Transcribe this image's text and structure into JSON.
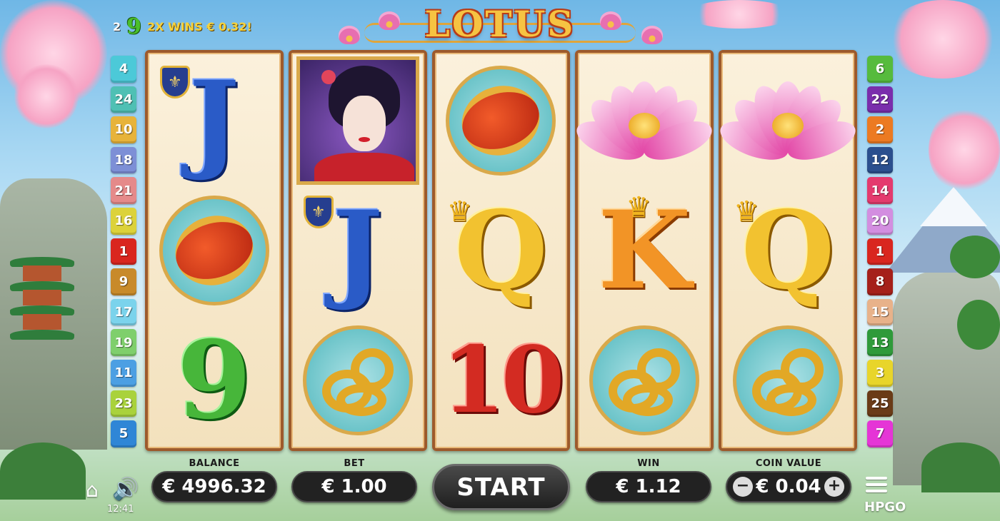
{
  "game": {
    "title": "LOTUS"
  },
  "win_message": {
    "line": "2",
    "symbol": "9",
    "text": "2X WINS € 0.32!"
  },
  "paylines": {
    "left": [
      {
        "number": "4",
        "color": "#4cc9d8"
      },
      {
        "number": "24",
        "color": "#4fc0b4"
      },
      {
        "number": "10",
        "color": "#e7b33a"
      },
      {
        "number": "18",
        "color": "#7d8fd6"
      },
      {
        "number": "21",
        "color": "#e58a8a"
      },
      {
        "number": "16",
        "color": "#dcd23a"
      },
      {
        "number": "1",
        "color": "#d9261f"
      },
      {
        "number": "9",
        "color": "#c88a2a"
      },
      {
        "number": "17",
        "color": "#7bd3ec"
      },
      {
        "number": "19",
        "color": "#7fcf6c"
      },
      {
        "number": "11",
        "color": "#4c9fe3"
      },
      {
        "number": "23",
        "color": "#a9d23c"
      },
      {
        "number": "5",
        "color": "#2f86d6"
      }
    ],
    "right": [
      {
        "number": "6",
        "color": "#56bb3d"
      },
      {
        "number": "22",
        "color": "#7a2dac"
      },
      {
        "number": "2",
        "color": "#ec7a22"
      },
      {
        "number": "12",
        "color": "#2b4f8e"
      },
      {
        "number": "14",
        "color": "#e43a6e"
      },
      {
        "number": "20",
        "color": "#d38ee0"
      },
      {
        "number": "1",
        "color": "#d9261f"
      },
      {
        "number": "8",
        "color": "#a5201a"
      },
      {
        "number": "15",
        "color": "#e8b28a"
      },
      {
        "number": "13",
        "color": "#2f9a3a"
      },
      {
        "number": "3",
        "color": "#e8d52a"
      },
      {
        "number": "25",
        "color": "#6a3b17"
      },
      {
        "number": "7",
        "color": "#e535d6"
      }
    ]
  },
  "reels": [
    [
      {
        "type": "letter",
        "value": "J",
        "cls": "sym-J",
        "icon": "shield-fleur-de-lis-icon"
      },
      {
        "type": "lantern",
        "icon": "red-lantern-icon"
      },
      {
        "type": "letter",
        "value": "9",
        "cls": "sym-9"
      }
    ],
    [
      {
        "type": "geisha",
        "icon": "geisha-portrait-icon"
      },
      {
        "type": "letter",
        "value": "J",
        "cls": "sym-J",
        "icon": "shield-fleur-de-lis-icon"
      },
      {
        "type": "dragon",
        "icon": "golden-dragon-icon"
      }
    ],
    [
      {
        "type": "lantern",
        "icon": "red-lantern-icon"
      },
      {
        "type": "letter",
        "value": "Q",
        "cls": "sym-Q",
        "icon": "crown-icon"
      },
      {
        "type": "letter",
        "value": "10",
        "cls": "sym-10"
      }
    ],
    [
      {
        "type": "lotus",
        "icon": "pink-lotus-flower-icon"
      },
      {
        "type": "letter",
        "value": "K",
        "cls": "sym-K",
        "icon": "crown-icon"
      },
      {
        "type": "dragon",
        "icon": "golden-dragon-icon"
      }
    ],
    [
      {
        "type": "lotus",
        "icon": "pink-lotus-flower-icon"
      },
      {
        "type": "letter",
        "value": "Q",
        "cls": "sym-Q",
        "icon": "crown-icon"
      },
      {
        "type": "dragon",
        "icon": "golden-dragon-icon"
      }
    ]
  ],
  "controls": {
    "balance_label": "BALANCE",
    "balance_value": "€ 4996.32",
    "bet_label": "BET",
    "bet_value": "€ 1.00",
    "start_label": "START",
    "win_label": "WIN",
    "win_value": "€ 1.12",
    "coin_value_label": "COIN VALUE",
    "coin_value": "€ 0.04",
    "decrease_symbol": "−",
    "increase_symbol": "+",
    "clock": "12:41",
    "brand": "HPGO"
  }
}
